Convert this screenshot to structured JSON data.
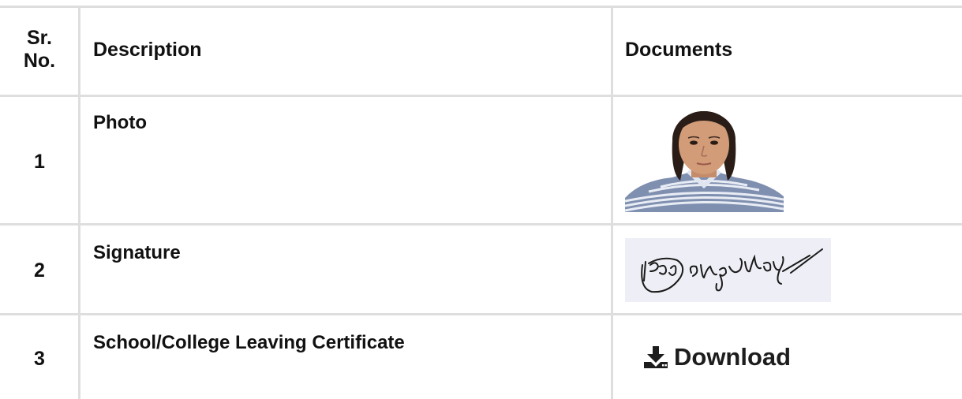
{
  "table": {
    "headers": {
      "sr_no_line1": "Sr.",
      "sr_no_line2": "No.",
      "description": "Description",
      "documents": "Documents"
    },
    "rows": [
      {
        "sr": "1",
        "description": "Photo",
        "document_type": "image"
      },
      {
        "sr": "2",
        "description": "Signature",
        "document_type": "signature"
      },
      {
        "sr": "3",
        "description": "School/College Leaving Certificate",
        "document_type": "download",
        "action_label": "Download",
        "action_icon": "download-icon"
      }
    ]
  },
  "colors": {
    "grid_line": "#dedede",
    "signature_bg": "#eeeef6",
    "text": "#111111"
  }
}
